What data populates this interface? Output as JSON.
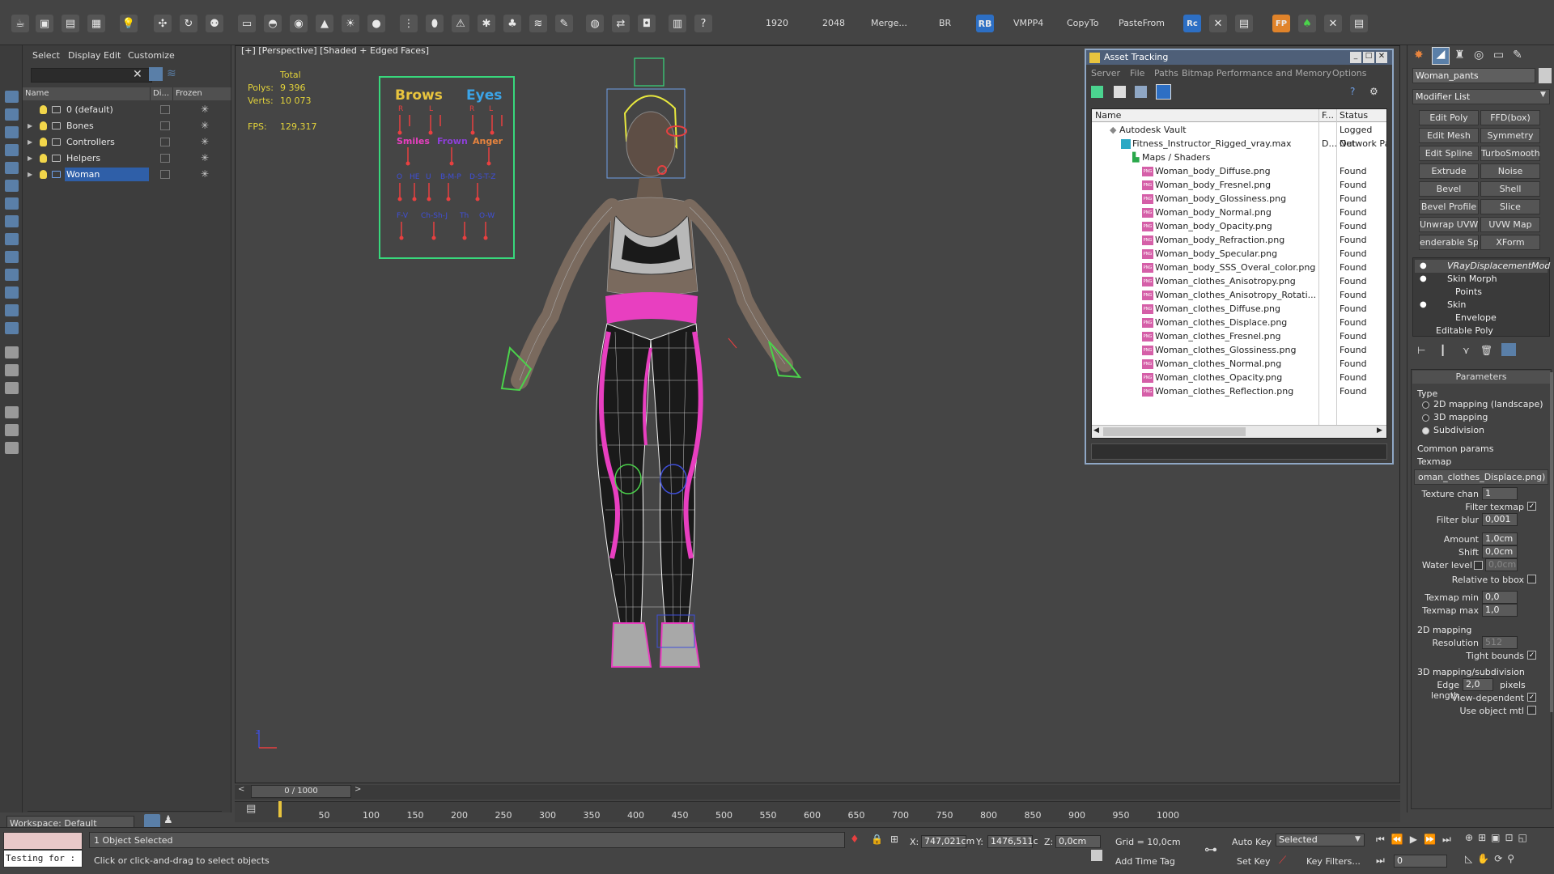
{
  "toolbar": {
    "items": [
      "1920",
      "2048",
      "Merge...",
      "BR",
      "VMPP4",
      "CopyTo",
      "PasteFrom"
    ],
    "rb_label": "RB",
    "rc_label": "Rc",
    "fp_label": "FP"
  },
  "explorer": {
    "menus": [
      "Select",
      "Display",
      "Edit",
      "Customize"
    ],
    "col_name": "Name",
    "col_display": "Di...",
    "col_frozen": "Frozen",
    "layers": [
      "0 (default)",
      "Bones",
      "Controllers",
      "Helpers",
      "Woman"
    ],
    "selected_layer": "Woman",
    "workspace": "Workspace: Default"
  },
  "viewport": {
    "label": "[+] [Perspective] [Shaded + Edged Faces]",
    "stats_total": "Total",
    "polys_label": "Polys:",
    "polys": "9 396",
    "verts_label": "Verts:",
    "verts": "10 073",
    "fps_label": "FPS:",
    "fps": "129,317",
    "face_panel": {
      "brows": "Brows",
      "eyes": "Eyes",
      "r": "R",
      "l": "L",
      "smiles": "Smiles",
      "frown": "Frown",
      "anger": "Anger",
      "row3": [
        "O",
        "HE",
        "U",
        "B-M-P",
        "D-S-T-Z"
      ],
      "row4": [
        "F-V",
        "Ch-Sh-J",
        "Th",
        "O-W"
      ]
    },
    "axis_z": "z"
  },
  "asset_tracking": {
    "title": "Asset Tracking",
    "menus": [
      "Server",
      "File",
      "Paths",
      "Bitmap Performance and Memory",
      "Options"
    ],
    "col_name": "Name",
    "col_f": "F...",
    "col_status": "Status",
    "vault": {
      "name": "Autodesk Vault",
      "status": "Logged Out"
    },
    "scene": {
      "name": "Fitness_Instructor_Rigged_vray.max",
      "f": "D...",
      "status": "Network Path"
    },
    "maps_folder": "Maps / Shaders",
    "png_badge": "PNG",
    "files": [
      {
        "name": "Woman_body_Diffuse.png",
        "status": "Found"
      },
      {
        "name": "Woman_body_Fresnel.png",
        "status": "Found"
      },
      {
        "name": "Woman_body_Glossiness.png",
        "status": "Found"
      },
      {
        "name": "Woman_body_Normal.png",
        "status": "Found"
      },
      {
        "name": "Woman_body_Opacity.png",
        "status": "Found"
      },
      {
        "name": "Woman_body_Refraction.png",
        "status": "Found"
      },
      {
        "name": "Woman_body_Specular.png",
        "status": "Found"
      },
      {
        "name": "Woman_body_SSS_Overal_color.png",
        "status": "Found"
      },
      {
        "name": "Woman_clothes_Anisotropy.png",
        "status": "Found"
      },
      {
        "name": "Woman_clothes_Anisotropy_Rotati...",
        "status": "Found"
      },
      {
        "name": "Woman_clothes_Diffuse.png",
        "status": "Found"
      },
      {
        "name": "Woman_clothes_Displace.png",
        "status": "Found"
      },
      {
        "name": "Woman_clothes_Fresnel.png",
        "status": "Found"
      },
      {
        "name": "Woman_clothes_Glossiness.png",
        "status": "Found"
      },
      {
        "name": "Woman_clothes_Normal.png",
        "status": "Found"
      },
      {
        "name": "Woman_clothes_Opacity.png",
        "status": "Found"
      },
      {
        "name": "Woman_clothes_Reflection.png",
        "status": "Found"
      }
    ]
  },
  "command_panel": {
    "object_name": "Woman_pants",
    "modifier_list": "Modifier List",
    "buttons": [
      "Edit Poly",
      "FFD(box)",
      "Edit Mesh",
      "Symmetry",
      "Edit Spline",
      "TurboSmooth",
      "Extrude",
      "Noise",
      "Bevel",
      "Shell",
      "Bevel Profile",
      "Slice",
      "Unwrap UVW",
      "UVW Map",
      "enderable Splin",
      "XForm"
    ],
    "stack": [
      "VRayDisplacementMod",
      "Skin Morph",
      "Points",
      "Skin",
      "Envelope",
      "Editable Poly"
    ],
    "params_title": "Parameters",
    "type_label": "Type",
    "type_options": [
      "2D mapping (landscape)",
      "3D mapping",
      "Subdivision"
    ],
    "common_params": "Common params",
    "texmap_label": "Texmap",
    "texmap_value": "oman_clothes_Displace.png)",
    "texture_chan_label": "Texture chan",
    "texture_chan": "1",
    "filter_texmap": "Filter texmap",
    "filter_blur_label": "Filter blur",
    "filter_blur": "0,001",
    "amount_label": "Amount",
    "amount": "1,0cm",
    "shift_label": "Shift",
    "shift": "0,0cm",
    "water_level_label": "Water level",
    "water_level": "0,0cm",
    "relative_bbox": "Relative to bbox",
    "texmap_min_label": "Texmap min",
    "texmap_min": "0,0",
    "texmap_max_label": "Texmap max",
    "texmap_max": "1,0",
    "mapping2d": "2D mapping",
    "resolution_label": "Resolution",
    "resolution": "512",
    "tight_bounds": "Tight bounds",
    "mapping3d": "3D mapping/subdivision",
    "edge_length_label": "Edge length",
    "edge_length": "2,0",
    "pixels": "pixels",
    "view_dependent": "View-dependent",
    "use_object_mtl": "Use object mtl"
  },
  "timeline": {
    "frame": "0 / 1000",
    "ticks": [
      "50",
      "100",
      "150",
      "200",
      "250",
      "300",
      "350",
      "400",
      "450",
      "500",
      "550",
      "600",
      "650",
      "700",
      "750",
      "800",
      "850",
      "900",
      "950",
      "1000"
    ]
  },
  "status": {
    "maxscript": "Testing for :",
    "selected": "1 Object Selected",
    "prompt": "Click or click-and-drag to select objects",
    "x_label": "X:",
    "x": "747,021cm",
    "y_label": "Y:",
    "y": "1476,511c",
    "z_label": "Z:",
    "z": "0,0cm",
    "grid": "Grid = 10,0cm",
    "add_time_tag": "Add Time Tag",
    "auto_key": "Auto Key",
    "set_key": "Set Key",
    "selected_dropdown": "Selected",
    "key_filters": "Key Filters...",
    "frame_input": "0"
  }
}
